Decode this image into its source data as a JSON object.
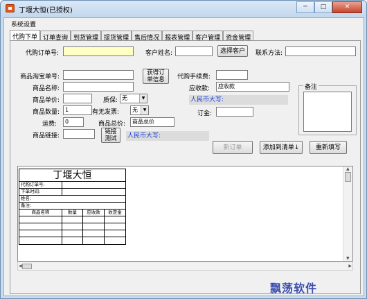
{
  "window": {
    "title": "丁堰大恒(已授权)",
    "min": "─",
    "max": "□",
    "close": "✕"
  },
  "menu": {
    "settings": "系统设置"
  },
  "tabs": [
    {
      "label": "代购下单",
      "active": true
    },
    {
      "label": "订单查询"
    },
    {
      "label": "到货管理"
    },
    {
      "label": "提货管理"
    },
    {
      "label": "售后情况"
    },
    {
      "label": "报表管理"
    },
    {
      "label": "客户管理"
    },
    {
      "label": "资金管理"
    }
  ],
  "form": {
    "order_no_label": "代购订单号:",
    "order_no_value": "",
    "customer_label": "客户姓名:",
    "customer_value": "",
    "select_customer": "选择客户",
    "contact_label": "联系方法:",
    "contact_value": "",
    "taobao_label": "商品淘宝单号:",
    "get_order_info": "获得订\n单信息",
    "fee_label": "代购手续费:",
    "goods_name_label": "商品名称:",
    "receivable_label": "应收款:",
    "receivable_value": "应收款",
    "price_label": "商品单价:",
    "warranty_label": "质保:",
    "warranty_value": "无",
    "rmb_upper_1": "人民币大写:",
    "qty_label": "商品数量:",
    "qty_value": "1",
    "invoice_label": "有无发票:",
    "invoice_value": "无",
    "deposit_label": "订金:",
    "shipping_label": "运费:",
    "shipping_value": "0",
    "total_label": "商品总价:",
    "total_value": "商品总价",
    "link_label": "商品链接:",
    "link_test": "链接\n测试",
    "rmb_upper_2": "人民币大写:",
    "new_order": "新订单",
    "add_to_list": "添加到清单↓",
    "refill": "重新填写",
    "remark_label": "备注"
  },
  "receipt": {
    "title": "丁堰大恒",
    "rows": [
      "代购订单号:",
      "下单时间:",
      "姓名:",
      "备注:"
    ],
    "columns": [
      "商品名称",
      "数量",
      "应收款",
      "收定金"
    ]
  },
  "watermark": "飘荡软件"
}
